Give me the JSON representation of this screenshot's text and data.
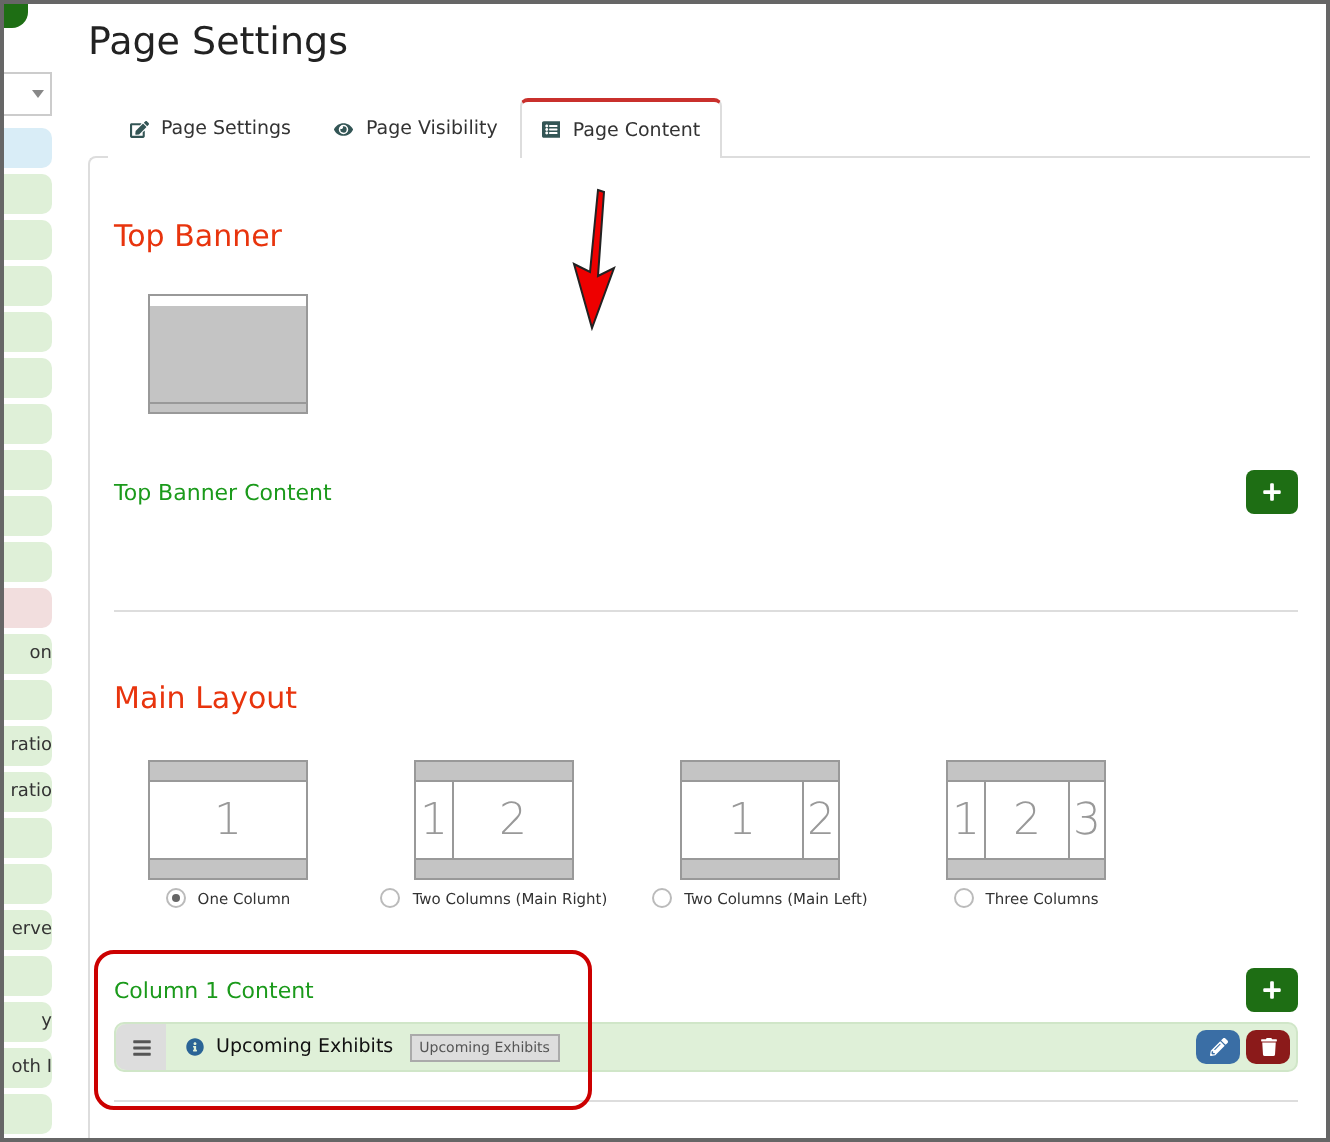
{
  "sidebar": {
    "items": [
      {
        "color": "#d9edf7"
      },
      {
        "color": "#dff0d8"
      },
      {
        "color": "#dff0d8"
      },
      {
        "color": "#dff0d8"
      },
      {
        "color": "#dff0d8"
      },
      {
        "color": "#dff0d8"
      },
      {
        "color": "#dff0d8"
      },
      {
        "color": "#dff0d8"
      },
      {
        "color": "#dff0d8"
      },
      {
        "color": "#dff0d8"
      },
      {
        "color": "#f2dede"
      },
      {
        "label": "on",
        "color": "#dff0d8"
      },
      {
        "color": "#dff0d8"
      },
      {
        "label": "ratio",
        "color": "#dff0d8"
      },
      {
        "label": "ratio",
        "color": "#dff0d8"
      },
      {
        "color": "#dff0d8"
      },
      {
        "color": "#dff0d8"
      },
      {
        "label": "erve",
        "color": "#dff0d8"
      },
      {
        "color": "#dff0d8"
      },
      {
        "label": "y",
        "color": "#dff0d8"
      },
      {
        "label": "oth I",
        "color": "#dff0d8"
      },
      {
        "color": "#dff0d8"
      }
    ]
  },
  "title": "Page Settings",
  "tabs": [
    {
      "label": "Page Settings",
      "selected": false
    },
    {
      "label": "Page Visibility",
      "selected": false
    },
    {
      "label": "Page Content",
      "selected": true
    }
  ],
  "top_banner": {
    "heading": "Top Banner",
    "content_label": "Top Banner Content"
  },
  "main_layout": {
    "heading": "Main Layout",
    "options": [
      {
        "label": "One Column",
        "selected": true,
        "panes": [
          {
            "label": "1",
            "kind": "wide"
          }
        ]
      },
      {
        "label": "Two Columns (Main Right)",
        "selected": false,
        "panes": [
          {
            "label": "1",
            "kind": "narrow"
          },
          {
            "label": "2",
            "kind": "wide"
          }
        ]
      },
      {
        "label": "Two Columns (Main Left)",
        "selected": false,
        "panes": [
          {
            "label": "1",
            "kind": "wide"
          },
          {
            "label": "2",
            "kind": "narrow"
          }
        ]
      },
      {
        "label": "Three Columns",
        "selected": false,
        "panes": [
          {
            "label": "1",
            "kind": "narrow"
          },
          {
            "label": "2",
            "kind": "wide"
          },
          {
            "label": "3",
            "kind": "narrow"
          }
        ]
      }
    ]
  },
  "column_1": {
    "heading": "Column 1 Content",
    "items": [
      {
        "title": "Upcoming Exhibits",
        "tag": "Upcoming Exhibits"
      }
    ]
  }
}
